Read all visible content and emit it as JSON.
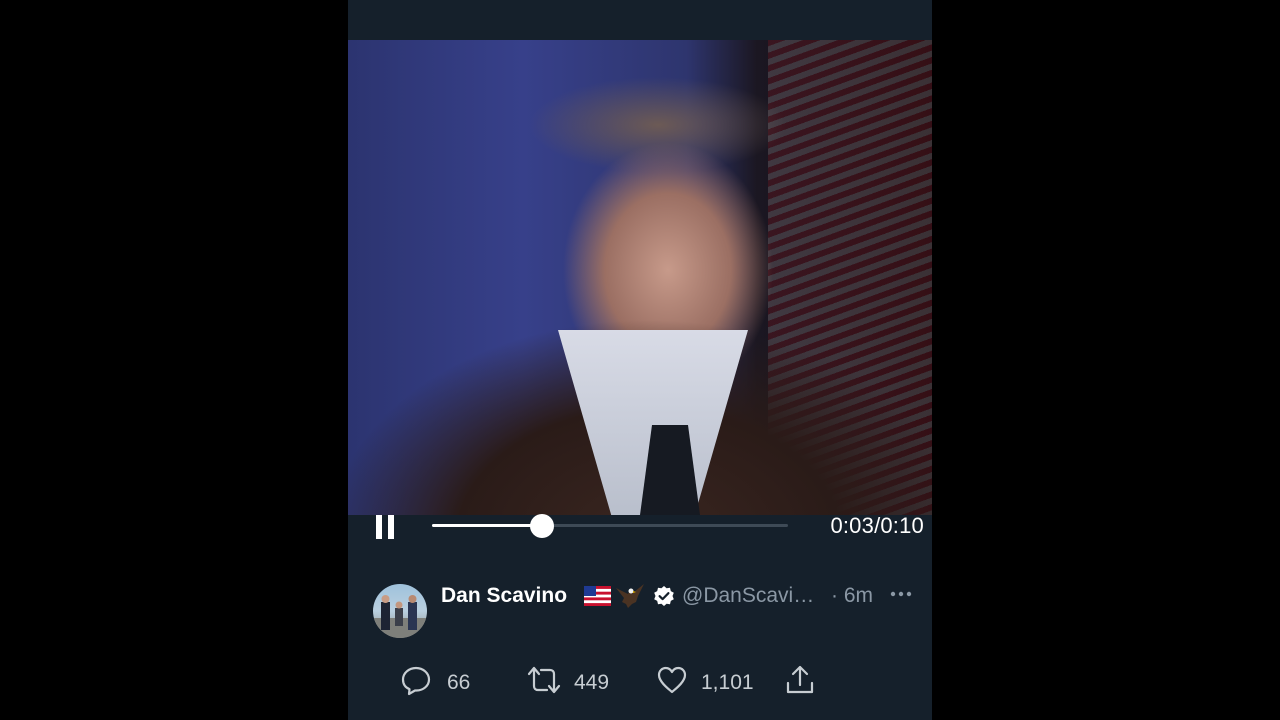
{
  "video": {
    "elapsed": "0:03",
    "separator": "/",
    "duration": "0:10",
    "progress_fraction": 0.3,
    "state": "playing",
    "pause_icon": "pause-icon"
  },
  "tweet": {
    "author_name": "Dan Scavino",
    "name_emojis": [
      "us-flag-emoji",
      "eagle-emoji"
    ],
    "verified": true,
    "handle": "@DanScavi…",
    "time_ago": "· 6m",
    "more_icon": "more-options-icon"
  },
  "actions": {
    "reply": {
      "icon": "reply-icon",
      "count": "66"
    },
    "retweet": {
      "icon": "retweet-icon",
      "count": "449"
    },
    "like": {
      "icon": "heart-icon",
      "count": "1,101"
    },
    "share": {
      "icon": "share-icon"
    }
  },
  "colors": {
    "background": "#15202b",
    "text_primary": "#ffffff",
    "text_secondary": "#8b98a5",
    "verified_badge": "#ffffff"
  }
}
